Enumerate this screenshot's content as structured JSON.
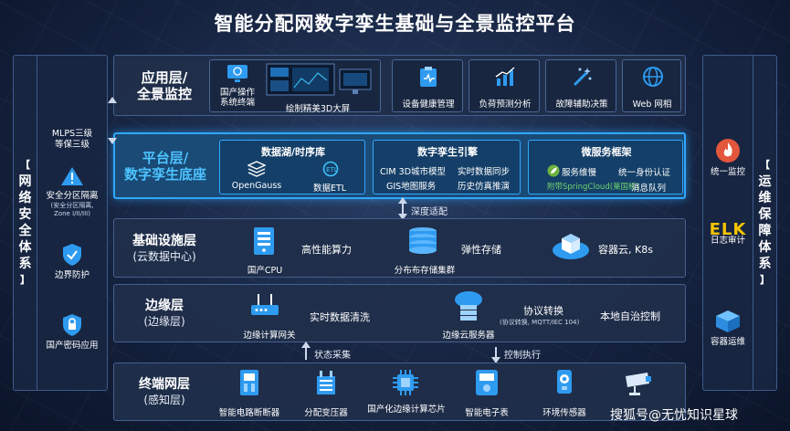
{
  "title": "智能分配网数字孪生基础与全景监控平台",
  "left_panel": {
    "label_chars": [
      "网",
      "络",
      "安",
      "全",
      "体",
      "系"
    ],
    "items": [
      {
        "label": "MLPS三级",
        "label2": "等保三级"
      },
      {
        "label": "安全分区隔离",
        "sub1": "(安全分区隔离,",
        "sub2": "Zone I/II/III)"
      },
      {
        "label": "边界防护"
      },
      {
        "label": "国产密码应用"
      }
    ]
  },
  "right_panel": {
    "label_chars": [
      "运",
      "维",
      "保",
      "障",
      "体",
      "系"
    ],
    "items": [
      {
        "label": "统一监控"
      },
      {
        "label": "日志审计",
        "logo": "ELK"
      },
      {
        "label": "容器运维"
      }
    ]
  },
  "layers": {
    "app": {
      "name1": "应用层/",
      "name2": "全景监控",
      "terminal": "国产操作",
      "terminal2": "系统终端",
      "screen": "绘制精美3D大屏",
      "items": [
        "设备健康管理",
        "负荷预测分析",
        "故障辅助决策",
        "Web 网相"
      ]
    },
    "platform": {
      "name1": "平台层/",
      "name2": "数字孪生底座",
      "datalake": {
        "title": "数据湖/时序库",
        "db": "OpenGauss",
        "etl": "数据ETL"
      },
      "twin": {
        "title": "数字孪生引擎",
        "r1a": "CIM 3D城市模型",
        "r1b": "实时数据同步",
        "r2a": "GIS地图服务",
        "r2b": "历史仿真推演"
      },
      "micro": {
        "title": "微服务框架",
        "a": "服务维慢",
        "b": "统一身份认证",
        "c": "附带SpringCloud(",
        "c2": "莱国标)",
        "d": "消息队列"
      }
    },
    "infra": {
      "name1": "基础设施层",
      "name2": "(云数据中心)",
      "cpu": "国产CPU",
      "compute": "高性能算力",
      "storage_cluster": "分布布存储集群",
      "storage": "弹性存储",
      "container": "容器云, K8s"
    },
    "edge": {
      "name1": "边缘层",
      "name2": "(边缘层)",
      "gateway": "边缘计算网关",
      "clean": "实时数据清洗",
      "server": "边缘云服务器",
      "protocol": "协议转换",
      "protocol_sub": "(协议转换, MQTT/IEC 104)",
      "autonomy": "本地自治控制"
    },
    "terminal": {
      "name1": "终端网层",
      "name2": "(感知层)",
      "items": [
        "智能电路断断器",
        "分配变压器",
        "国产化边缘计算芯片",
        "智能电子表",
        "环境传感器"
      ]
    }
  },
  "arrows": {
    "depth": "深度适配",
    "collect": "状态采集",
    "control": "控制执行"
  },
  "watermark": "搜狐号@无忧知识星球",
  "colors": {
    "highlight": "#2fa8ff",
    "background": "#14213d",
    "panel_border": "#44608f"
  }
}
